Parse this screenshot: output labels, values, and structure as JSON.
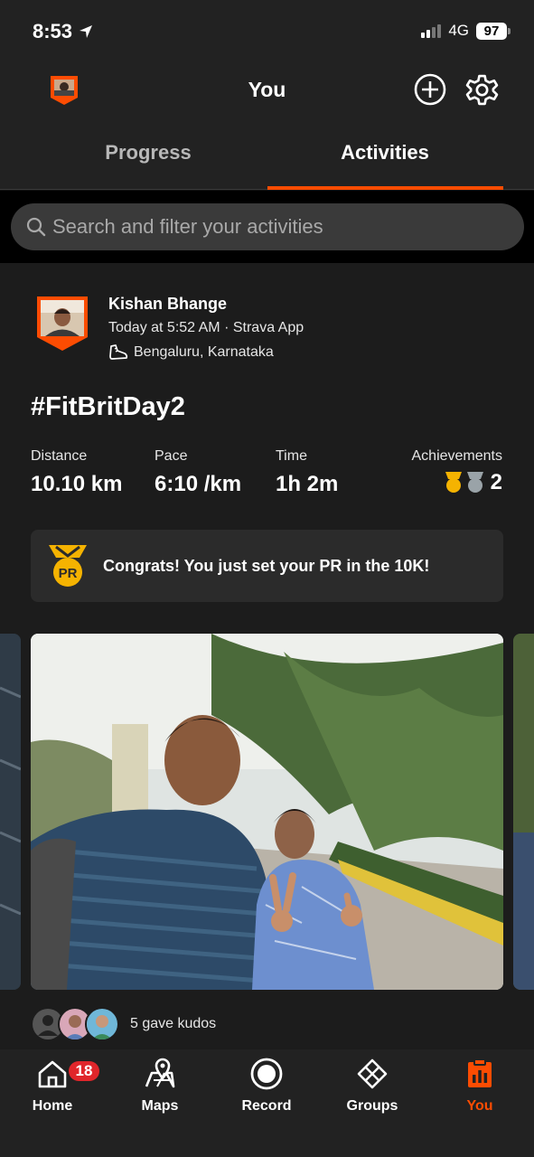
{
  "status_bar": {
    "time": "8:53",
    "network": "4G",
    "battery": "97"
  },
  "header": {
    "title": "You"
  },
  "tabs": [
    {
      "label": "Progress"
    },
    {
      "label": "Activities"
    }
  ],
  "search": {
    "placeholder": "Search and filter your activities"
  },
  "activity": {
    "athlete": "Kishan Bhange",
    "meta": "Today at 5:52 AM · Strava App",
    "location": "Bengaluru, Karnataka",
    "title": "#FitBritDay2",
    "stats": [
      {
        "label": "Distance",
        "value": "10.10 km"
      },
      {
        "label": "Pace",
        "value": "6:10 /km"
      },
      {
        "label": "Time",
        "value": "1h 2m"
      }
    ],
    "achievements": {
      "label": "Achievements",
      "count": "2"
    },
    "pr_banner": {
      "medal_text": "PR",
      "text": "Congrats! You just set your PR in the 10K!"
    },
    "kudos": "5 gave kudos"
  },
  "tabbar": {
    "items": [
      {
        "label": "Home",
        "icon": "home-icon",
        "badge": "18"
      },
      {
        "label": "Maps",
        "icon": "maps-icon"
      },
      {
        "label": "Record",
        "icon": "record-icon"
      },
      {
        "label": "Groups",
        "icon": "groups-icon"
      },
      {
        "label": "You",
        "icon": "you-icon"
      }
    ]
  },
  "colors": {
    "accent": "#fc4c02",
    "badge": "#e0262b",
    "gold": "#f5b301"
  }
}
